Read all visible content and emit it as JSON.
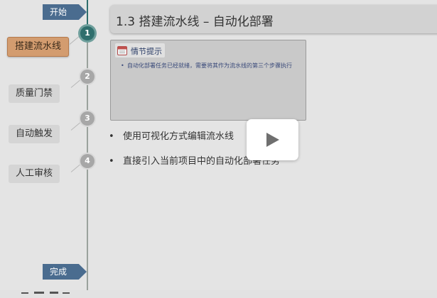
{
  "timeline": {
    "start_label": "开始",
    "end_label": "完成",
    "steps": [
      {
        "number": "1",
        "label": "搭建流水线",
        "active": true
      },
      {
        "number": "2",
        "label": "质量门禁",
        "active": false
      },
      {
        "number": "3",
        "label": "自动触发",
        "active": false
      },
      {
        "number": "4",
        "label": "人工审核",
        "active": false
      }
    ]
  },
  "main": {
    "title": "1.3 搭建流水线 – 自动化部署",
    "hint": {
      "icon": "calendar-icon",
      "title": "情节提示",
      "items": [
        "自动化部署任务已经就绪，需要将其作为流水线的第三个步骤执行"
      ]
    },
    "bullets": [
      "使用可视化方式编辑流水线",
      "直接引入当前项目中的自动化部署任务"
    ]
  },
  "video": {
    "play_icon": "play-icon",
    "button_color": "#ffffff"
  },
  "colors": {
    "accent_teal": "#2f6f6d",
    "active_step": "#d39c6f",
    "tag_blue": "#4a6c8f"
  }
}
